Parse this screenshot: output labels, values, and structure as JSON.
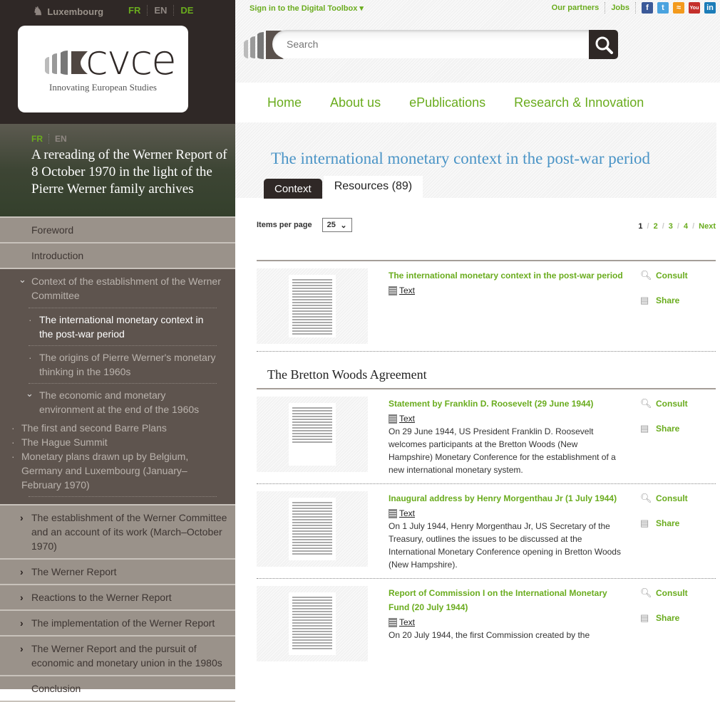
{
  "top_left": {
    "country": "Luxembourg",
    "languages": [
      {
        "code": "FR",
        "active": true
      },
      {
        "code": "EN",
        "active": false
      },
      {
        "code": "DE",
        "active": true
      }
    ]
  },
  "logo": {
    "word": "cvce",
    "tagline": "Innovating European Studies"
  },
  "hero": {
    "languages": [
      "FR",
      "EN"
    ],
    "title": "A rereading of the Werner Report of 8 October 1970 in the light of the Pierre Werner family archives"
  },
  "sidebar": {
    "foreword": "Foreword",
    "introduction": "Introduction",
    "context": {
      "label": "Context of the establishment of the Werner Committee",
      "children": [
        {
          "label": "The international monetary context in the post-war period",
          "active": true
        },
        {
          "label": "The origins of Pierre Werner's monetary thinking in the 1960s"
        },
        {
          "label": "The economic and monetary environment at the end of the 1960s",
          "children": [
            "The first and second Barre Plans",
            "The Hague Summit",
            "Monetary plans drawn up by Belgium, Germany and Luxembourg (January–February 1970)"
          ]
        }
      ]
    },
    "items": [
      "The establishment of the Werner Committee and an account of its work (March–October 1970)",
      "The Werner Report",
      "Reactions to the Werner Report",
      "The implementation of the Werner Report",
      "The Werner Report and the pursuit of economic and monetary union in the 1980s"
    ],
    "conclusion": "Conclusion"
  },
  "header": {
    "signin": "Sign in to the Digital Toolbox ▾",
    "partners": "Our partners",
    "jobs": "Jobs",
    "social": [
      "facebook",
      "twitter",
      "rss",
      "youtube",
      "linkedin"
    ],
    "search_placeholder": "Search"
  },
  "nav": [
    "Home",
    "About us",
    "ePublications",
    "Research & Innovation"
  ],
  "page": {
    "title": "The international monetary context in the post-war period",
    "tabs": {
      "context": "Context",
      "resources": "Resources (89)"
    }
  },
  "listing": {
    "items_per_page_label": "Items per page",
    "items_per_page_value": "25",
    "pages": [
      "1",
      "2",
      "3",
      "4"
    ],
    "current_page": "1",
    "next": "Next",
    "consult": "Consult",
    "share": "Share",
    "type_text": "Text",
    "section": "The Bretton Woods Agreement",
    "first": {
      "title": "The international monetary context in the post-war period"
    },
    "items": [
      {
        "title": "Statement by Franklin D. Roosevelt (29 June 1944)",
        "description": "On 29 June 1944, US President Franklin D. Roosevelt welcomes participants at the Bretton Woods (New Hampshire) Monetary Conference for the establishment of a new international monetary system."
      },
      {
        "title": "Inaugural address by Henry Morgenthau Jr (1 July 1944)",
        "description": "On 1 July 1944, Henry Morgenthau Jr, US Secretary of the Treasury, outlines the issues to be discussed at the International Monetary Conference opening in Bretton Woods (New Hampshire)."
      },
      {
        "title": "Report of Commission I on the International Monetary Fund (20 July 1944)",
        "description": "On 20 July 1944, the first Commission created by the"
      }
    ]
  }
}
